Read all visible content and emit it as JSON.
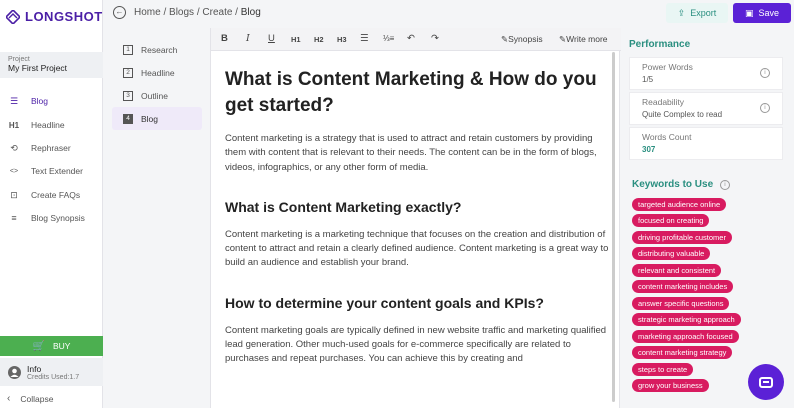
{
  "brand": {
    "name": "LONGSHOT",
    "color": "#4b1fa6"
  },
  "project": {
    "label": "Project",
    "name": "My First Project"
  },
  "nav": [
    {
      "icon": "blog-list-icon",
      "glyph": "☰",
      "label": "Blog",
      "active": true
    },
    {
      "icon": "headline-h1-icon",
      "glyph": "H1",
      "label": "Headline",
      "active": false
    },
    {
      "icon": "rephrase-icon",
      "glyph": "⟲",
      "label": "Rephraser",
      "active": false
    },
    {
      "icon": "code-brackets-icon",
      "glyph": "<>",
      "label": "Text Extender",
      "active": false
    },
    {
      "icon": "faq-chat-icon",
      "glyph": "⊡",
      "label": "Create FAQs",
      "active": false
    },
    {
      "icon": "synopsis-list-icon",
      "glyph": "≡",
      "label": "Blog Synopsis",
      "active": false
    }
  ],
  "buy": {
    "label": "BUY",
    "color": "#4caf50"
  },
  "info": {
    "title": "Info",
    "credits": "Credits Used:1.7"
  },
  "collapse": {
    "label": "Collapse"
  },
  "breadcrumb": {
    "home": "Home",
    "sep": " / ",
    "blogs": "Blogs",
    "create": "Create",
    "current": "Blog"
  },
  "actions": {
    "export": "Export",
    "save": "Save",
    "accent": "#5b21d6"
  },
  "steps": [
    {
      "num": "1",
      "label": "Research",
      "active": false
    },
    {
      "num": "2",
      "label": "Headline",
      "active": false
    },
    {
      "num": "3",
      "label": "Outline",
      "active": false
    },
    {
      "num": "4",
      "label": "Blog",
      "active": true
    }
  ],
  "toolbar": {
    "bold": "B",
    "italic": "I",
    "underline": "U",
    "h1": "H1",
    "h2": "H2",
    "h3": "H3",
    "synopsis": "Synopsis",
    "write_more": "Write more"
  },
  "article": {
    "title": "What is Content Marketing & How do you get started?",
    "p1": "Content marketing is a strategy that is used to attract and retain customers by providing them with content that is relevant to their needs. The content can be in the form of blogs, videos, infographics, or any other form of media.",
    "h2a": "What is Content Marketing exactly?",
    "p2": "Content marketing is a marketing technique that focuses on the creation and distribution of content to attract and retain a clearly defined audience. Content marketing is a great way to build an audience and establish your brand.",
    "h2b": "How to determine your content goals and KPIs?",
    "p3": "Content marketing goals are typically defined in new website traffic and marketing qualified lead generation. Other much-used goals for e-commerce specifically are related to purchases and repeat purchases. You can achieve this by creating and"
  },
  "performance": {
    "title": "Performance",
    "power_words": {
      "label": "Power Words",
      "value": "1/5"
    },
    "readability": {
      "label": "Readability",
      "value": "Quite Complex to read"
    },
    "words_count": {
      "label": "Words Count",
      "value": "307"
    }
  },
  "keywords": {
    "title": "Keywords to Use",
    "color": "#d81b60",
    "items": [
      "targeted audience online",
      "focused on creating",
      "driving profitable customer",
      "distributing valuable",
      "relevant and consistent",
      "content marketing includes",
      "answer specific questions",
      "strategic marketing approach",
      "marketing approach focused",
      "content marketing strategy",
      "steps to create",
      "grow your business"
    ]
  }
}
